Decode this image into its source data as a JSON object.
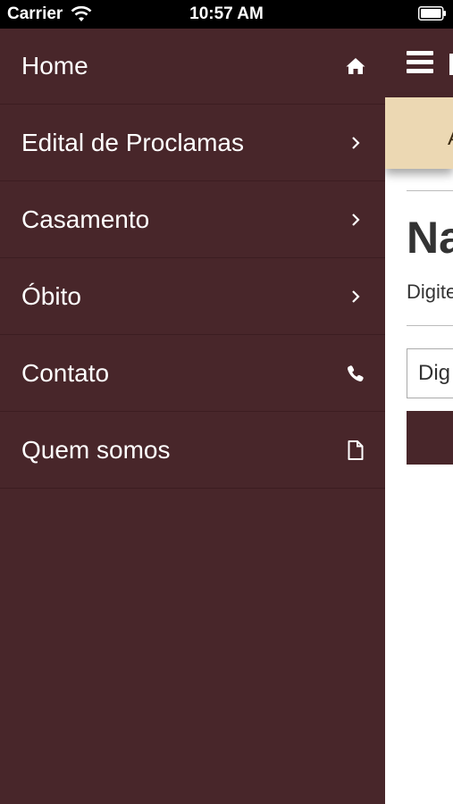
{
  "status_bar": {
    "carrier": "Carrier",
    "time": "10:57 AM"
  },
  "menu": {
    "items": [
      {
        "label": "Home",
        "icon": "home-icon"
      },
      {
        "label": "Edital de Proclamas",
        "icon": "chevron-right-icon"
      },
      {
        "label": "Casamento",
        "icon": "chevron-right-icon"
      },
      {
        "label": "Óbito",
        "icon": "chevron-right-icon"
      },
      {
        "label": "Contato",
        "icon": "phone-icon"
      },
      {
        "label": "Quem somos",
        "icon": "document-icon"
      }
    ]
  },
  "main": {
    "heading": "Na",
    "subtext": "Digite",
    "input_value": "Dig"
  },
  "colors": {
    "drawer": "#48262a",
    "banner": "#ecd8b3",
    "text_light": "#ffffff"
  }
}
